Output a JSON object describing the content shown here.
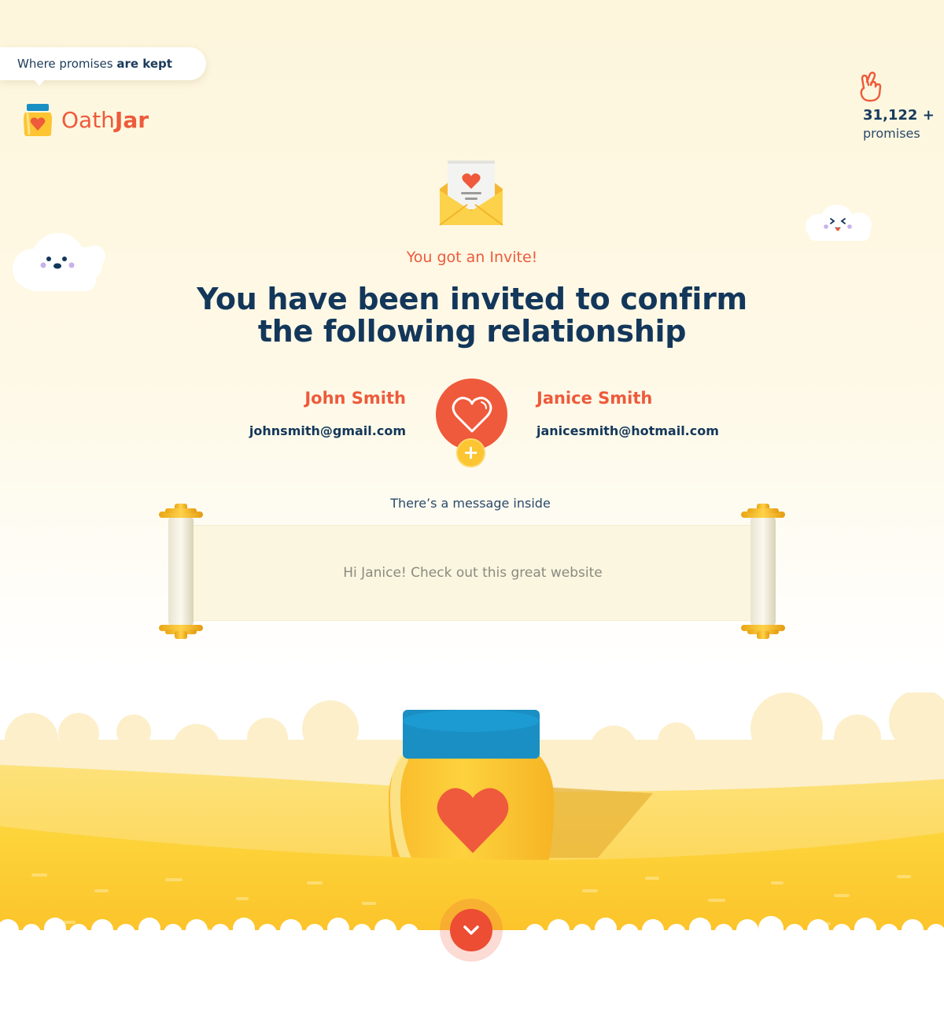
{
  "header": {
    "tagline_prefix": "Where promises",
    "tagline_bold": "are kept",
    "logo_word_light": "Oath",
    "logo_word_bold": "Jar"
  },
  "stats": {
    "count": "31,122 +",
    "label": "promises",
    "icon": "crossed-fingers-icon"
  },
  "invite": {
    "kicker": "You got an Invite!",
    "headline_line1": "You have been invited to confirm",
    "headline_line2": "the following relationship",
    "icon": "love-letter-envelope-icon"
  },
  "relationship": {
    "person1": {
      "name": "John Smith",
      "email": "johnsmith@gmail.com"
    },
    "person2": {
      "name": "Janice Smith",
      "email": "janicesmith@hotmail.com"
    },
    "center_icon": "heart-icon",
    "badge_icon": "plus-icon"
  },
  "message": {
    "label": "There’s a message inside",
    "text": "Hi Janice! Check out this great website"
  },
  "footer": {
    "scroll_button_icon": "chevron-down-icon"
  },
  "colors": {
    "accent": "#ee5a3b",
    "navy": "#13375a",
    "gold": "#fcc531",
    "jar_lid": "#1a8fc4"
  }
}
